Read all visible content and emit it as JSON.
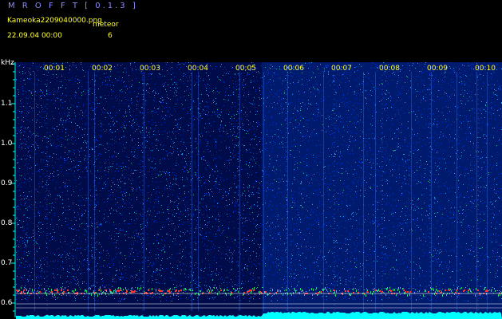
{
  "header": {
    "app_title": "M R O F F T [ 0.1.3 ]",
    "file_name": "Kameoka2209040000.png",
    "meteor_label": "meteor",
    "date_time": "22.09.04 00:00",
    "meteor_count": "6"
  },
  "y_axis": {
    "unit": "kHz",
    "ticks": [
      "1.1",
      "1.0",
      "0.9",
      "0.8",
      "0.7",
      "0.6"
    ]
  },
  "time_axis": {
    "labels": [
      "00:01",
      "00:02",
      "00:03",
      "00:04",
      "00:05",
      "00:06",
      "00:07",
      "00:08",
      "00:09",
      "00:10"
    ]
  },
  "colors": {
    "background": "#000000",
    "noise_dark": "#000f55",
    "noise_mid": "#0033cc",
    "noise_hi": "#33bbff",
    "signal_green": "#33ff88",
    "signal_red": "#ff3333",
    "baseline_cyan": "#00ffff",
    "label_yellow": "#ffff33",
    "title_blue": "#8c8cff"
  }
}
